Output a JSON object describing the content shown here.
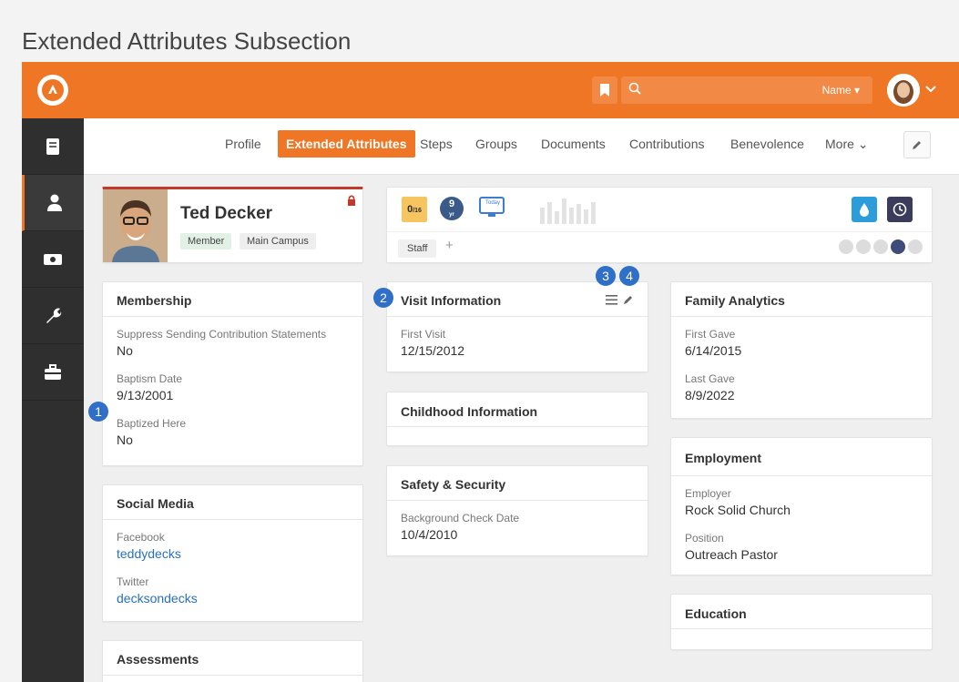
{
  "caption": "Extended Attributes Subsection",
  "search": {
    "filter_label": "Name ▾"
  },
  "tabs": [
    {
      "label": "Profile"
    },
    {
      "label": "Extended Attributes"
    },
    {
      "label": "Steps"
    },
    {
      "label": "Groups"
    },
    {
      "label": "Documents"
    },
    {
      "label": "Contributions"
    },
    {
      "label": "Benevolence"
    },
    {
      "label": "More ⌄"
    }
  ],
  "person": {
    "name": "Ted Decker",
    "badges": [
      "Member",
      "Main Campus"
    ]
  },
  "stats": {
    "engagement_value": "0",
    "engagement_total": "/16",
    "years_value": "9",
    "years_unit": "yr",
    "today_label": "Today",
    "tag": "Staff",
    "add_tag": "+"
  },
  "membership": {
    "title": "Membership",
    "fields": [
      {
        "label": "Suppress Sending Contribution Statements",
        "value": "No"
      },
      {
        "label": "Baptism Date",
        "value": "9/13/2001"
      },
      {
        "label": "Baptized Here",
        "value": "No"
      }
    ]
  },
  "social": {
    "title": "Social Media",
    "fields": [
      {
        "label": "Facebook",
        "value": "teddydecks"
      },
      {
        "label": "Twitter",
        "value": "decksondecks"
      }
    ]
  },
  "assessments": {
    "title": "Assessments"
  },
  "visit": {
    "title": "Visit Information",
    "fields": [
      {
        "label": "First Visit",
        "value": "12/15/2012"
      }
    ]
  },
  "childhood": {
    "title": "Childhood Information"
  },
  "safety": {
    "title": "Safety & Security",
    "fields": [
      {
        "label": "Background Check Date",
        "value": "10/4/2010"
      }
    ]
  },
  "family": {
    "title": "Family Analytics",
    "fields": [
      {
        "label": "First Gave",
        "value": "6/14/2015"
      },
      {
        "label": "Last Gave",
        "value": "8/9/2022"
      }
    ]
  },
  "employment": {
    "title": "Employment",
    "fields": [
      {
        "label": "Employer",
        "value": "Rock Solid Church"
      },
      {
        "label": "Position",
        "value": "Outreach Pastor"
      }
    ]
  },
  "education": {
    "title": "Education"
  },
  "markers": [
    "1",
    "2",
    "3",
    "4"
  ],
  "colors": {
    "brand": "#ee7625",
    "sidebar": "#2f2f2f",
    "marker": "#2f6fc8",
    "link": "#2770c2"
  }
}
